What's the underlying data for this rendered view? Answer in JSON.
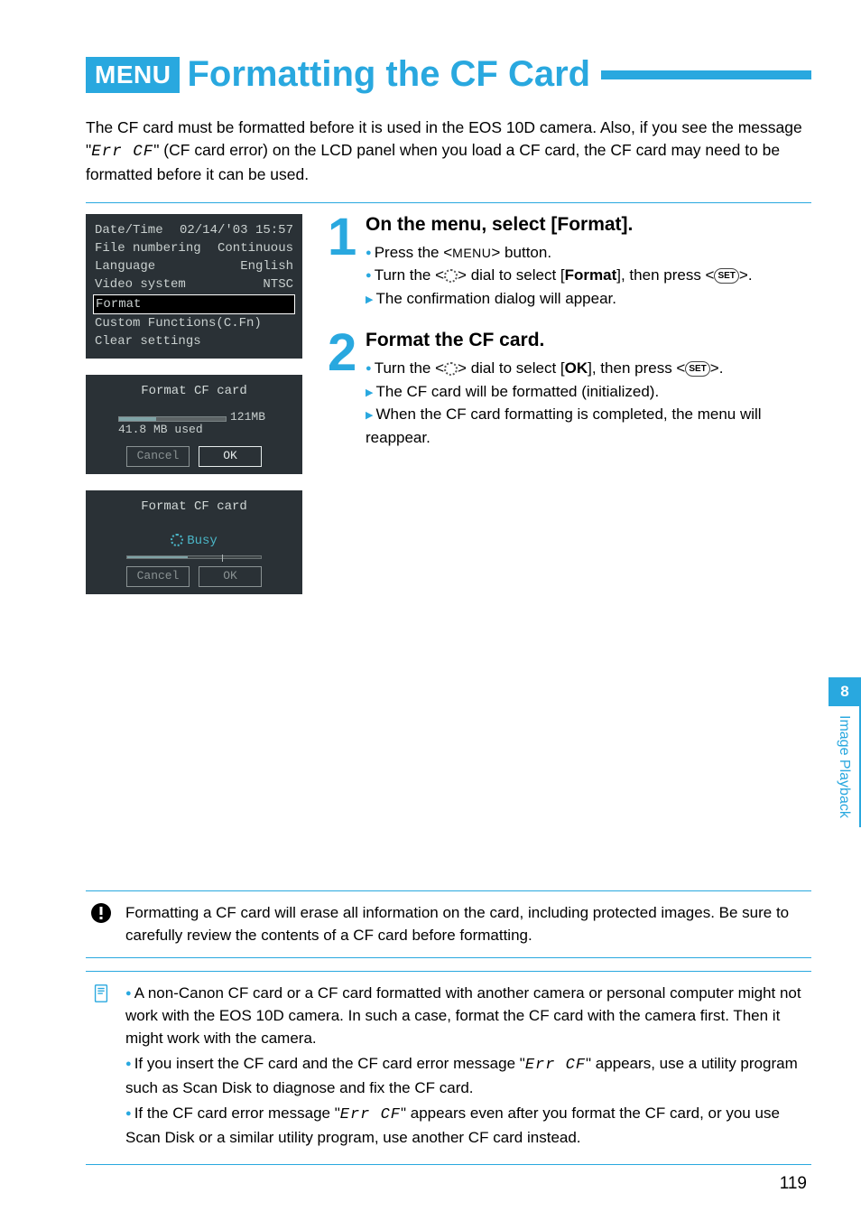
{
  "header": {
    "badge": "MENU",
    "title": "Formatting the CF Card"
  },
  "intro": {
    "p1a": "The CF card must be formatted before it is used in the EOS 10D camera. Also, if you see the message \"",
    "err": "Err CF",
    "p1b": "\" (CF card error) on the LCD panel when you load a CF card, the CF card may need to be formatted before it can be used."
  },
  "screen1": {
    "r1a": "Date/Time",
    "r1b": "02/14/'03 15:57",
    "r2a": "File numbering",
    "r2b": "Continuous",
    "r3a": "Language",
    "r3b": "English",
    "r4a": "Video system",
    "r4b": "NTSC",
    "r5a": "Format",
    "r6a": "Custom Functions(C.Fn)",
    "r7a": "Clear settings"
  },
  "screen2": {
    "title": "Format CF card",
    "used": "41.8 MB used",
    "cap": "121MB",
    "cancel": "Cancel",
    "ok": "OK"
  },
  "screen3": {
    "title": "Format CF card",
    "busy": "Busy",
    "cancel": "Cancel",
    "ok": "OK"
  },
  "step1": {
    "num": "1",
    "title": "On the menu, select [Format].",
    "b1a": "Press the <",
    "b1m": "MENU",
    "b1b": "> button.",
    "b2a": "Turn the <",
    "b2b": "> dial to select [",
    "b2f": "Format",
    "b2c": "], then press <",
    "b2d": ">.",
    "b3": "The confirmation dialog will appear."
  },
  "step2": {
    "num": "2",
    "title": "Format the CF card.",
    "b1a": "Turn the <",
    "b1b": "> dial to select [",
    "b1ok": "OK",
    "b1c": "], then press <",
    "b1d": ">.",
    "b2": "The CF card will be formatted (initialized).",
    "b3": "When the CF card formatting is completed, the menu will reappear."
  },
  "sidetab": {
    "num": "8",
    "label": "Image Playback"
  },
  "warn": {
    "text": "Formatting a CF card will erase all information on the card, including protected images. Be sure to carefully review the contents of a CF card before formatting."
  },
  "tips": {
    "t1": "A non-Canon CF card or a CF card formatted with another camera or personal computer might not work with the EOS 10D camera. In such a case, format the CF card with the camera first. Then it might work with the camera.",
    "t2a": "If you insert the CF card and the CF card error message \"",
    "t2err": "Err CF",
    "t2b": "\" appears, use a utility program such as Scan Disk to diagnose and fix the CF card.",
    "t3a": "If the CF card error message \"",
    "t3err": "Err CF",
    "t3b": "\" appears even after you format the CF card, or you use Scan Disk or a similar utility program, use another CF card instead."
  },
  "page_number": "119"
}
